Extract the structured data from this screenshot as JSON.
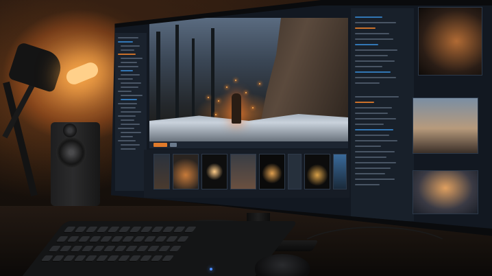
{
  "scene": {
    "colors": {
      "lamp_light": "#ffd08a",
      "ui_accent_orange": "#e07a2a",
      "ui_accent_blue": "#3a8dd8",
      "ui_panel": "#18202a",
      "ember": "#ffb45a"
    },
    "icons": [
      "desk-lamp",
      "speaker",
      "monitor",
      "keyboard",
      "mouse"
    ]
  }
}
